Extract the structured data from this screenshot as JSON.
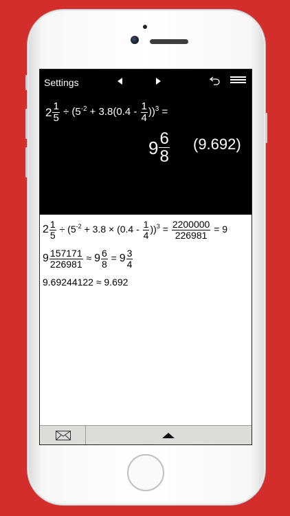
{
  "topbar": {
    "settings_label": "Settings",
    "icons": [
      "nav-left-icon",
      "nav-right-icon",
      "undo-icon",
      "menu-icon"
    ]
  },
  "display": {
    "expression": {
      "mixed_whole": "2",
      "mixed_num": "1",
      "mixed_den": "5",
      "seg1": " ÷ (5",
      "exp1": "-2",
      "seg2": " + 3.8(0.4 - ",
      "frac_num": "1",
      "frac_den": "4",
      "seg3": "))",
      "exp2": "3",
      "seg4": " ="
    },
    "result": {
      "whole": "9",
      "num": "6",
      "den": "8",
      "decimal": "(9.692)"
    }
  },
  "history": {
    "line1": {
      "mixed_whole": "2",
      "mixed_num": "1",
      "mixed_den": "5",
      "seg1": " ÷ (5",
      "exp1": "-2",
      "seg2": " + 3.8 × (0.4 - ",
      "frac_num": "1",
      "frac_den": "4",
      "seg3": "))",
      "exp2": "3",
      "seg4": " = ",
      "res_num": "2200000",
      "res_den": "226981",
      "seg5": " = 9"
    },
    "line2": {
      "w1": "9",
      "n1": "157171",
      "d1": "226981",
      "approx": " ≈ ",
      "w2": "9",
      "n2": "6",
      "d2": "8",
      "eq": " = ",
      "w3": "9",
      "n3": "3",
      "d3": "4"
    },
    "line3": "9.69244122 ≈ 9.692"
  },
  "toolbar": {
    "icons": [
      "mail-icon",
      "expand-up-icon"
    ]
  },
  "colors": {
    "background": "#d32d2c",
    "display_bg": "#000000",
    "history_bg": "#ffffff",
    "toolbar_bg": "#dcdcd8"
  }
}
